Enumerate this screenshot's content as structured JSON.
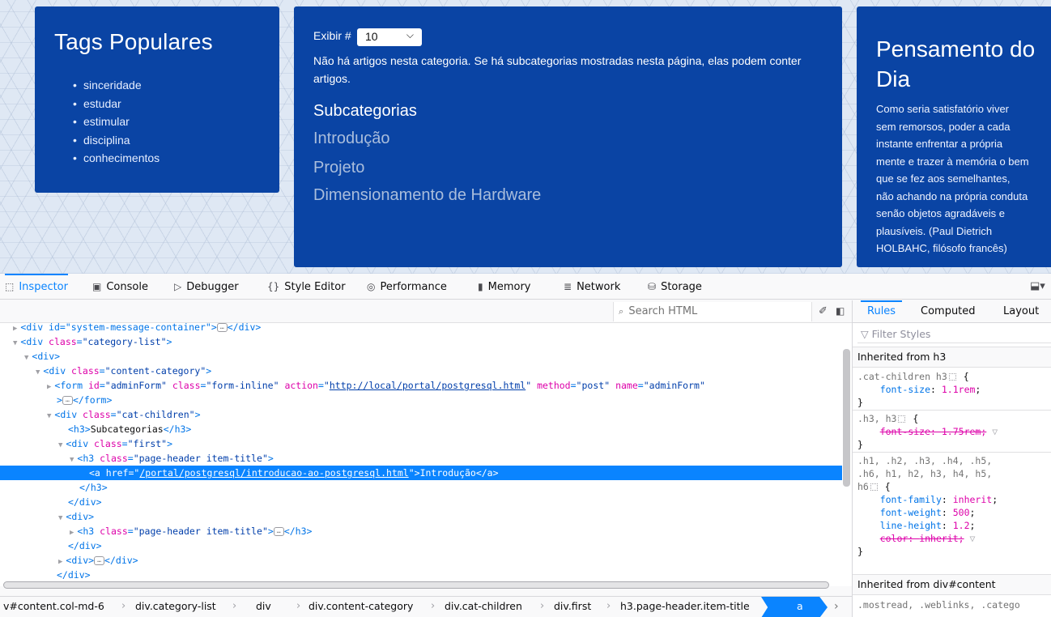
{
  "page": {
    "tags": {
      "title": "Tags Populares",
      "items": [
        "sinceridade",
        "estudar",
        "estimular",
        "disciplina",
        "conhecimentos"
      ]
    },
    "main": {
      "exibir_label": "Exibir #",
      "exibir_value": "10",
      "notice": "Não há artigos nesta categoria. Se há subcategorias mostradas nesta página, elas podem conter artigos.",
      "subcat_title": "Subcategorias",
      "subcats": [
        "Introdução",
        "Projeto",
        "Dimensionamento de Hardware"
      ]
    },
    "thought": {
      "title": "Pensamento do Dia",
      "text": "Como seria satisfatório viver sem remorsos, poder a cada instante enfrentar a própria mente e trazer à memória o bem que se fez aos semelhantes, não achando na própria conduta senão objetos agradáveis e plausíveis. (Paul Dietrich HOLBAHC, filósofo francês)"
    }
  },
  "devtools": {
    "tabs": [
      "Inspector",
      "Console",
      "Debugger",
      "Style Editor",
      "Performance",
      "Memory",
      "Network",
      "Storage"
    ],
    "active_tab": "Inspector",
    "search_placeholder": "Search HTML",
    "tree": {
      "r0_text": "<div id=\"system-message-container\">",
      "r1_attr": "category-list",
      "r3_attr": "content-category",
      "r4_id": "adminForm",
      "r4_class": "form-inline",
      "r4_action": "http://local/portal/postgresql.html",
      "r4_method": "post",
      "r4_name": "adminForm",
      "r6_attr": "cat-children",
      "r7_text": "Subcategorias",
      "r8_attr": "first",
      "r9_attr": "page-header item-title",
      "r10_href": "/portal/postgresql/introducao-ao-postgresql.html",
      "r10_text": "Introdução",
      "r14_attr": "page-header item-title"
    },
    "breadcrumbs": [
      "v#content.col-md-6",
      "div.category-list",
      "div",
      "div.content-category",
      "div.cat-children",
      "div.first",
      "h3.page-header.item-title",
      "a"
    ],
    "sidebar": {
      "tabs": [
        "Rules",
        "Computed",
        "Layout"
      ],
      "active_tab": "Rules",
      "filter_placeholder": "Filter Styles",
      "inherited_h3": "Inherited from h3",
      "inherited_div": "Inherited from div#content",
      "rule1_selector": ".cat-children h3",
      "rule1_prop": "font-size",
      "rule1_val": "1.1rem",
      "rule2_selector": ".h3, h3",
      "rule2_prop": "font-size",
      "rule2_val": "1.75rem",
      "rule3_selector_a": ".h1, .h2, .h3, .h4, .h5,",
      "rule3_selector_b": ".h6, h1, h2, h3, h4, h5,",
      "rule3_selector_c": "h6",
      "rule3_props": [
        {
          "prop": "font-family",
          "val": "inherit"
        },
        {
          "prop": "font-weight",
          "val": "500"
        },
        {
          "prop": "line-height",
          "val": "1.2"
        },
        {
          "prop": "color",
          "val": "inherit"
        }
      ],
      "last_selector": ".mostread, .weblinks, .catego"
    }
  },
  "colors": {
    "panel_blue": "#0a44a4",
    "accent": "#0a84ff",
    "tag": "#0074e8",
    "attr": "#dd00a9"
  }
}
